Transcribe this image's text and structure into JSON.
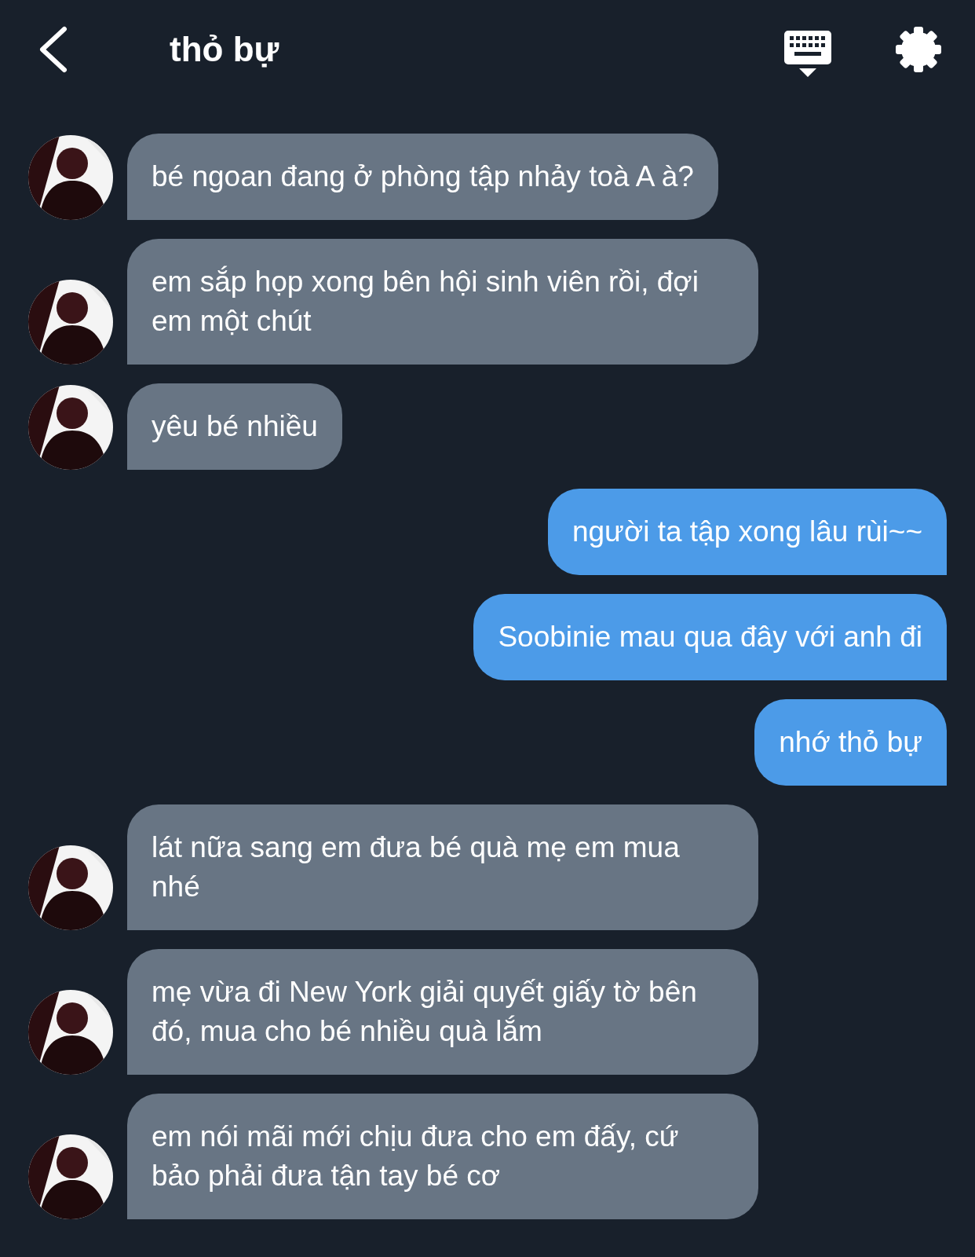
{
  "header": {
    "title": "thỏ bự"
  },
  "messages": [
    {
      "kind": "incoming",
      "text": "bé ngoan đang ở phòng tập nhảy toà A à?"
    },
    {
      "kind": "incoming",
      "text": "em sắp họp xong bên hội sinh viên rồi, đợi em một chút"
    },
    {
      "kind": "incoming",
      "text": "yêu bé nhiều"
    },
    {
      "kind": "outgoing",
      "text": "người ta tập xong lâu rùi~~"
    },
    {
      "kind": "outgoing",
      "text": "Soobinie mau qua đây với anh đi"
    },
    {
      "kind": "outgoing",
      "text": "nhớ thỏ bự"
    },
    {
      "kind": "incoming",
      "text": "lát nữa sang em đưa bé quà mẹ em mua nhé"
    },
    {
      "kind": "incoming",
      "text": "mẹ vừa đi New York giải quyết giấy tờ bên đó, mua cho bé nhiều quà lắm"
    },
    {
      "kind": "incoming",
      "text": "em nói mãi mới chịu đưa cho em đấy, cứ bảo phải đưa tận tay bé cơ"
    }
  ]
}
